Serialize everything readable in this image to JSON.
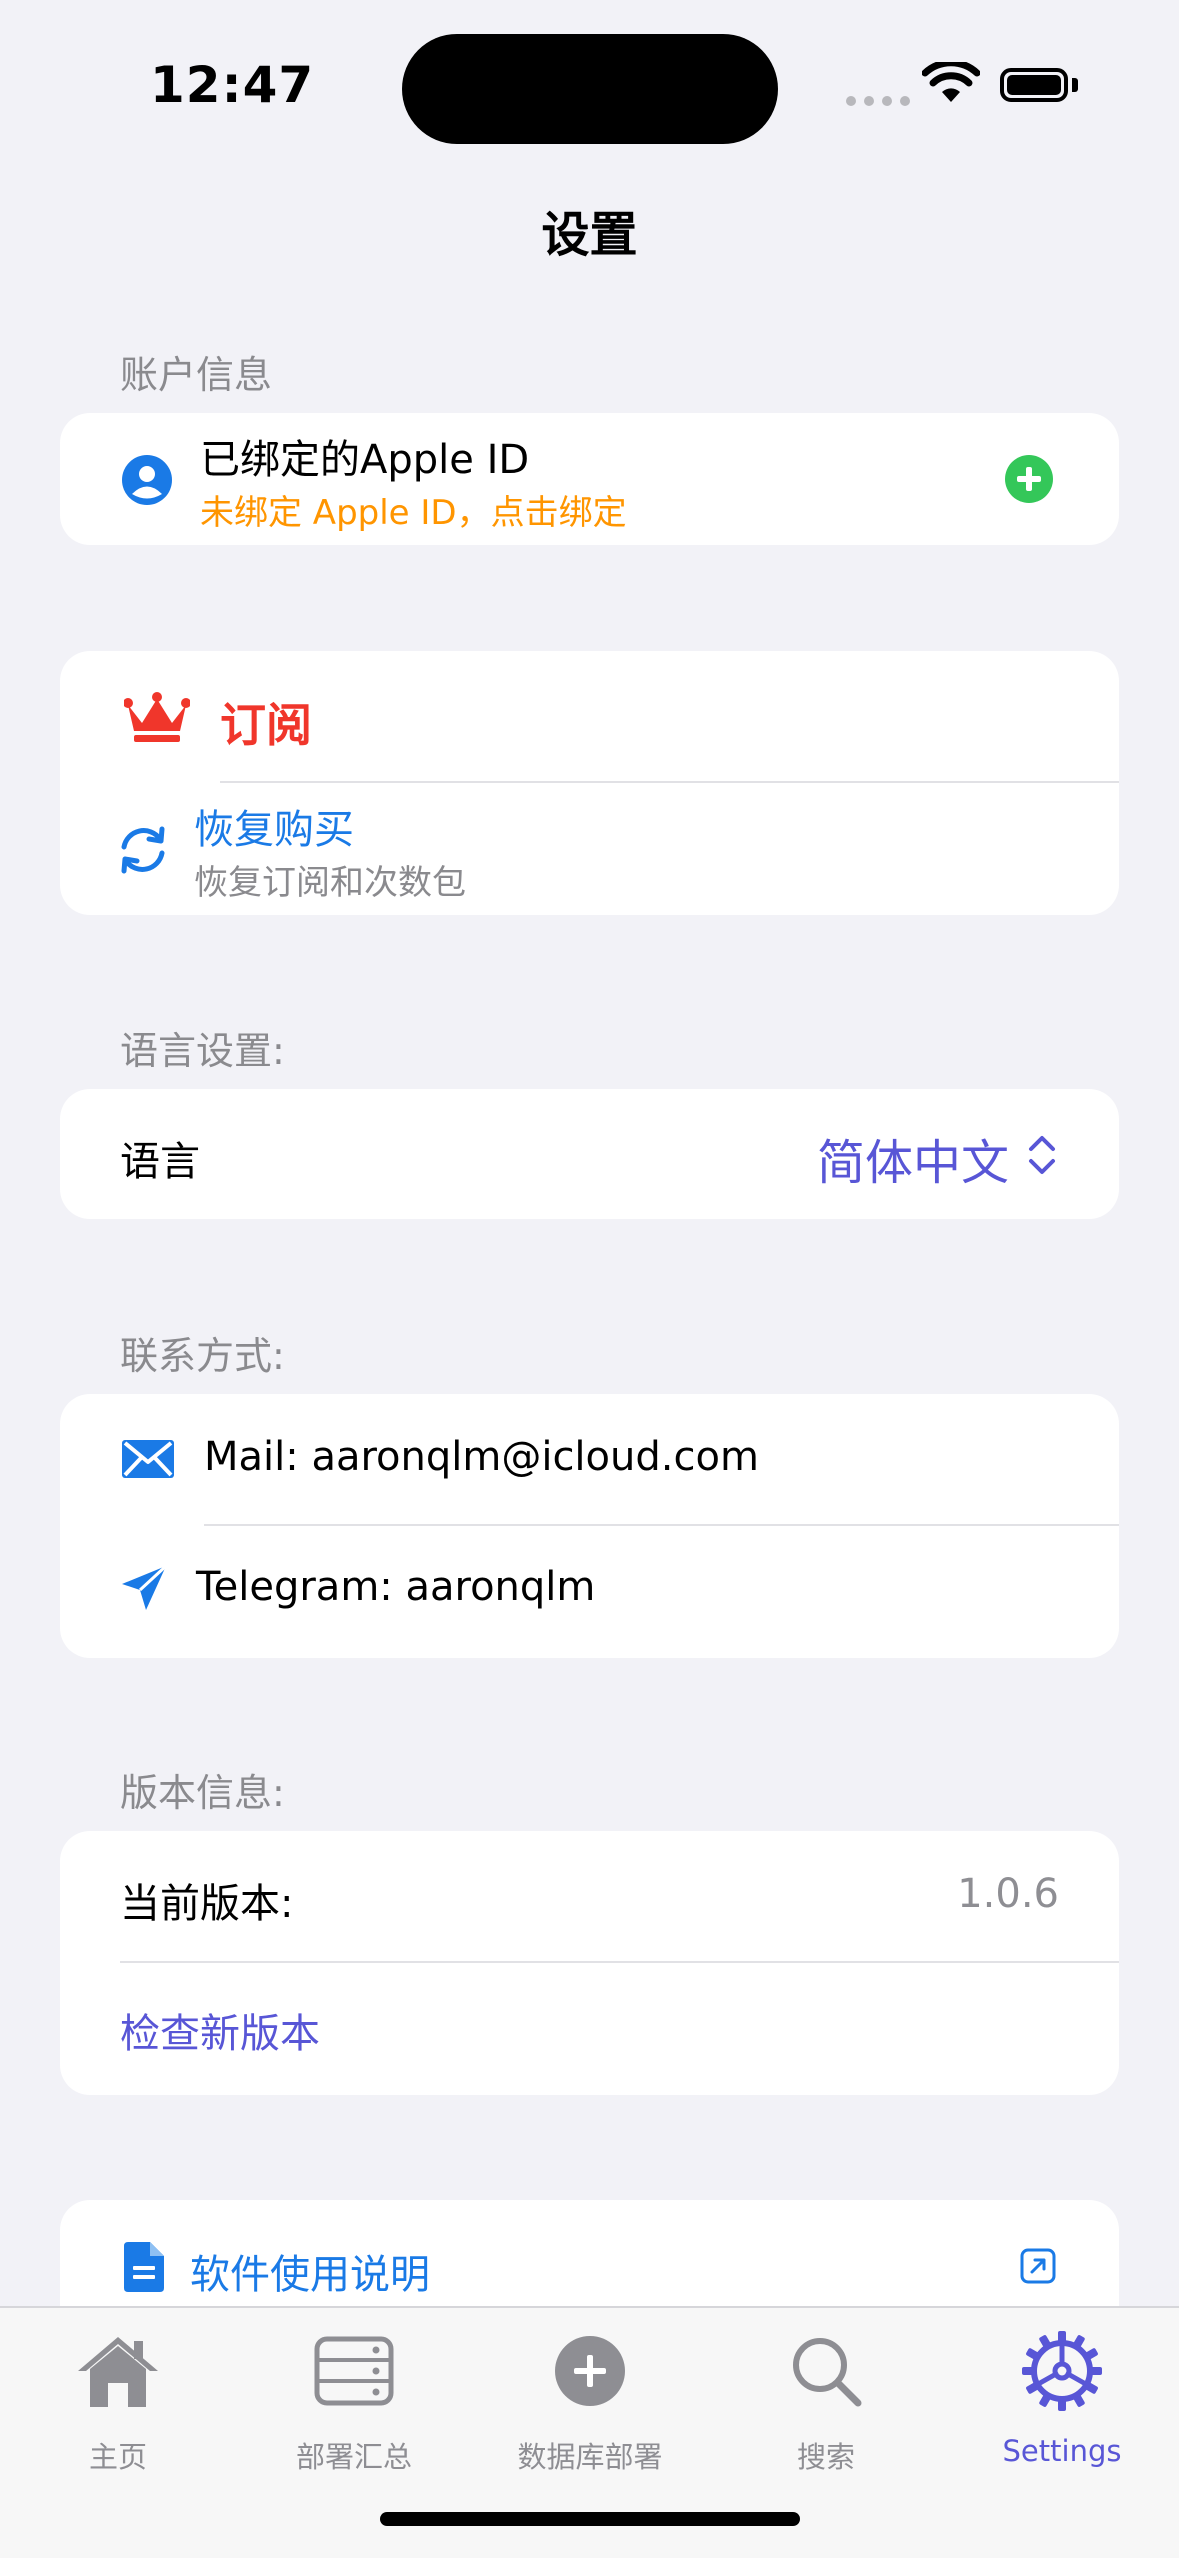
{
  "status_bar": {
    "time": "12:47"
  },
  "nav": {
    "title": "设置"
  },
  "account": {
    "section_label": "账户信息",
    "title": "已绑定的Apple ID",
    "subtitle": "未绑定 Apple ID，点击绑定"
  },
  "subscription": {
    "title": "订阅",
    "restore_title": "恢复购买",
    "restore_subtitle": "恢复订阅和次数包"
  },
  "language": {
    "section_label": "语言设置:",
    "label": "语言",
    "value": "简体中文"
  },
  "contact": {
    "section_label": "联系方式:",
    "mail": "Mail: aaronqlm@icloud.com",
    "telegram": "Telegram: aaronqlm"
  },
  "version": {
    "section_label": "版本信息:",
    "current_label": "当前版本:",
    "current_value": "1.0.6",
    "check_label": "检查新版本"
  },
  "docs": {
    "label": "软件使用说明"
  },
  "tabs": [
    {
      "label": "主页",
      "icon": "house-icon"
    },
    {
      "label": "部署汇总",
      "icon": "server-rack-icon"
    },
    {
      "label": "数据库部署",
      "icon": "plus-circle-icon"
    },
    {
      "label": "搜索",
      "icon": "magnifier-icon"
    },
    {
      "label": "Settings",
      "icon": "gear-icon"
    }
  ],
  "colors": {
    "background": "#F2F2F7",
    "accent_blue": "#1A7AE6",
    "accent_purple": "#5856D6",
    "warning_orange": "#FF9500",
    "danger_red": "#F0362B",
    "success_green": "#34C759",
    "secondary_text": "#8E8E93"
  }
}
